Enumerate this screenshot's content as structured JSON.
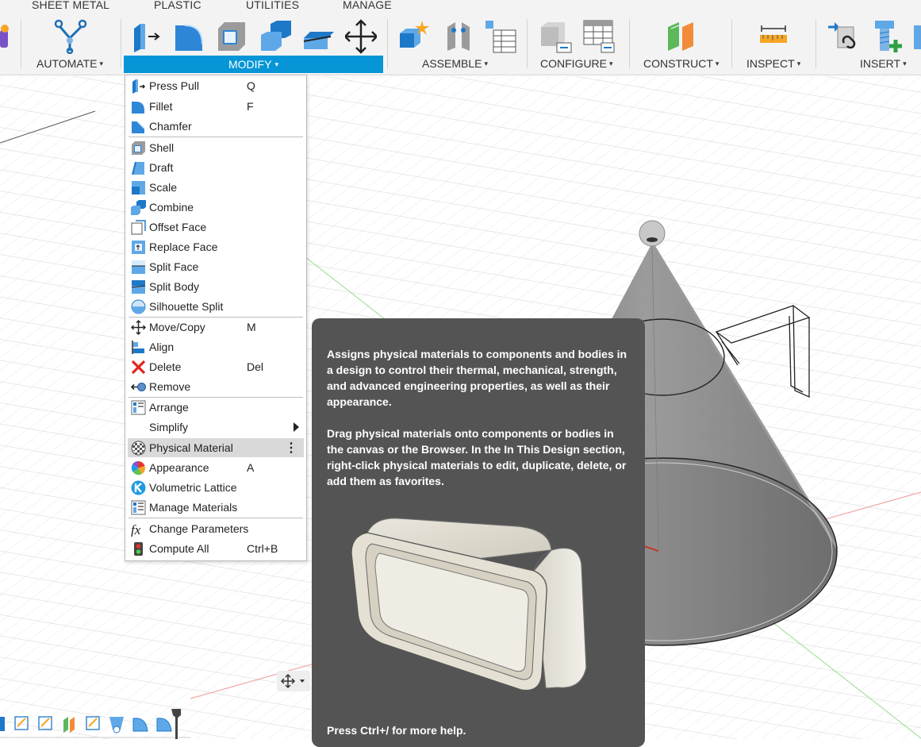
{
  "ribbon": {
    "tabs": [
      "SHEET METAL",
      "PLASTIC",
      "UTILITIES",
      "MANAGE"
    ],
    "groups": {
      "automate": "AUTOMATE",
      "modify": "MODIFY",
      "assemble": "ASSEMBLE",
      "configure": "CONFIGURE",
      "construct": "CONSTRUCT",
      "inspect": "INSPECT",
      "insert": "INSERT"
    },
    "caret": "▾",
    "accent_color": "#0696d7"
  },
  "menu": {
    "items": [
      {
        "label": "Press Pull",
        "shortcut": "Q",
        "icon": "press-pull-icon"
      },
      {
        "label": "Fillet",
        "shortcut": "F",
        "icon": "fillet-icon"
      },
      {
        "label": "Chamfer",
        "shortcut": "",
        "icon": "chamfer-icon"
      },
      {
        "label": "Shell",
        "shortcut": "",
        "icon": "shell-icon"
      },
      {
        "label": "Draft",
        "shortcut": "",
        "icon": "draft-icon"
      },
      {
        "label": "Scale",
        "shortcut": "",
        "icon": "scale-icon"
      },
      {
        "label": "Combine",
        "shortcut": "",
        "icon": "combine-icon"
      },
      {
        "label": "Offset Face",
        "shortcut": "",
        "icon": "offset-face-icon"
      },
      {
        "label": "Replace Face",
        "shortcut": "",
        "icon": "replace-face-icon"
      },
      {
        "label": "Split Face",
        "shortcut": "",
        "icon": "split-face-icon"
      },
      {
        "label": "Split Body",
        "shortcut": "",
        "icon": "split-body-icon"
      },
      {
        "label": "Silhouette Split",
        "shortcut": "",
        "icon": "silhouette-split-icon"
      },
      {
        "label": "Move/Copy",
        "shortcut": "M",
        "icon": "move-copy-icon"
      },
      {
        "label": "Align",
        "shortcut": "",
        "icon": "align-icon"
      },
      {
        "label": "Delete",
        "shortcut": "Del",
        "icon": "delete-icon"
      },
      {
        "label": "Remove",
        "shortcut": "",
        "icon": "remove-icon"
      },
      {
        "label": "Arrange",
        "shortcut": "",
        "icon": "arrange-icon"
      },
      {
        "label": "Simplify",
        "shortcut": "",
        "icon": "simplify-icon"
      },
      {
        "label": "Physical Material",
        "shortcut": "",
        "icon": "physical-material-icon"
      },
      {
        "label": "Appearance",
        "shortcut": "A",
        "icon": "appearance-icon"
      },
      {
        "label": "Volumetric Lattice",
        "shortcut": "",
        "icon": "volumetric-lattice-icon"
      },
      {
        "label": "Manage Materials",
        "shortcut": "",
        "icon": "manage-materials-icon"
      },
      {
        "label": "Change Parameters",
        "shortcut": "",
        "icon": "fx-icon"
      },
      {
        "label": "Compute All",
        "shortcut": "Ctrl+B",
        "icon": "compute-all-icon"
      }
    ],
    "highlighted": "Physical Material"
  },
  "tooltip": {
    "paragraph1": "Assigns physical materials to components and bodies in a design to control their thermal, mechanical, strength, and advanced engineering properties, as well as their appearance.",
    "paragraph2": "Drag physical materials onto components or bodies in the canvas or the Browser. In the In This Design section, right-click physical materials to edit, duplicate, delete, or add them as favorites.",
    "footer": "Press Ctrl+/ for more help."
  }
}
